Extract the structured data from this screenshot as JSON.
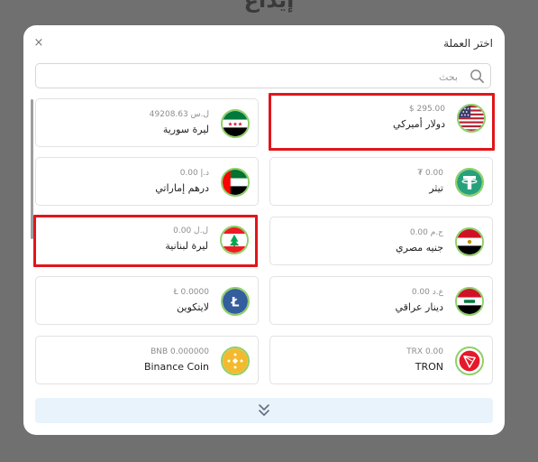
{
  "background": {
    "title": "إيداع"
  },
  "modal": {
    "title": "اختر العملة",
    "close_glyph": "×",
    "search": {
      "placeholder": "بحث",
      "value": ""
    }
  },
  "currencies": [
    {
      "name": "دولار أميركي",
      "balance": "$ 295.00",
      "icon": "flag-usa-icon",
      "selected": true
    },
    {
      "name": "ليرة سورية",
      "balance": "49208.63 ل.س",
      "icon": "flag-syria-icon",
      "selected": false
    },
    {
      "name": "تيثر",
      "balance": "₮ 0.00",
      "icon": "tether-icon",
      "selected": false
    },
    {
      "name": "درهم إماراتي",
      "balance": "0.00 د.إ",
      "icon": "flag-uae-icon",
      "selected": false
    },
    {
      "name": "جنيه مصري",
      "balance": "0.00 ج.م",
      "icon": "flag-egypt-icon",
      "selected": false
    },
    {
      "name": "ليرة لبنانية",
      "balance": "0.00 ل.ل",
      "icon": "flag-lebanon-icon",
      "selected": true
    },
    {
      "name": "دينار عراقي",
      "balance": "0.00 ع.د",
      "icon": "flag-iraq-icon",
      "selected": false
    },
    {
      "name": "لايتكوين",
      "balance": "Ł 0.0000",
      "icon": "litecoin-icon",
      "selected": false
    },
    {
      "name": "TRON",
      "balance": "TRX 0.00",
      "icon": "tron-icon",
      "selected": false
    },
    {
      "name": "Binance Coin",
      "balance": "BNB 0.000000",
      "icon": "bnb-icon",
      "selected": false
    }
  ],
  "colors": {
    "accent_green": "#8fcf68",
    "highlight_red": "#e0161b",
    "load_more_bg": "#e9f3fb",
    "overlay": "#707070"
  }
}
